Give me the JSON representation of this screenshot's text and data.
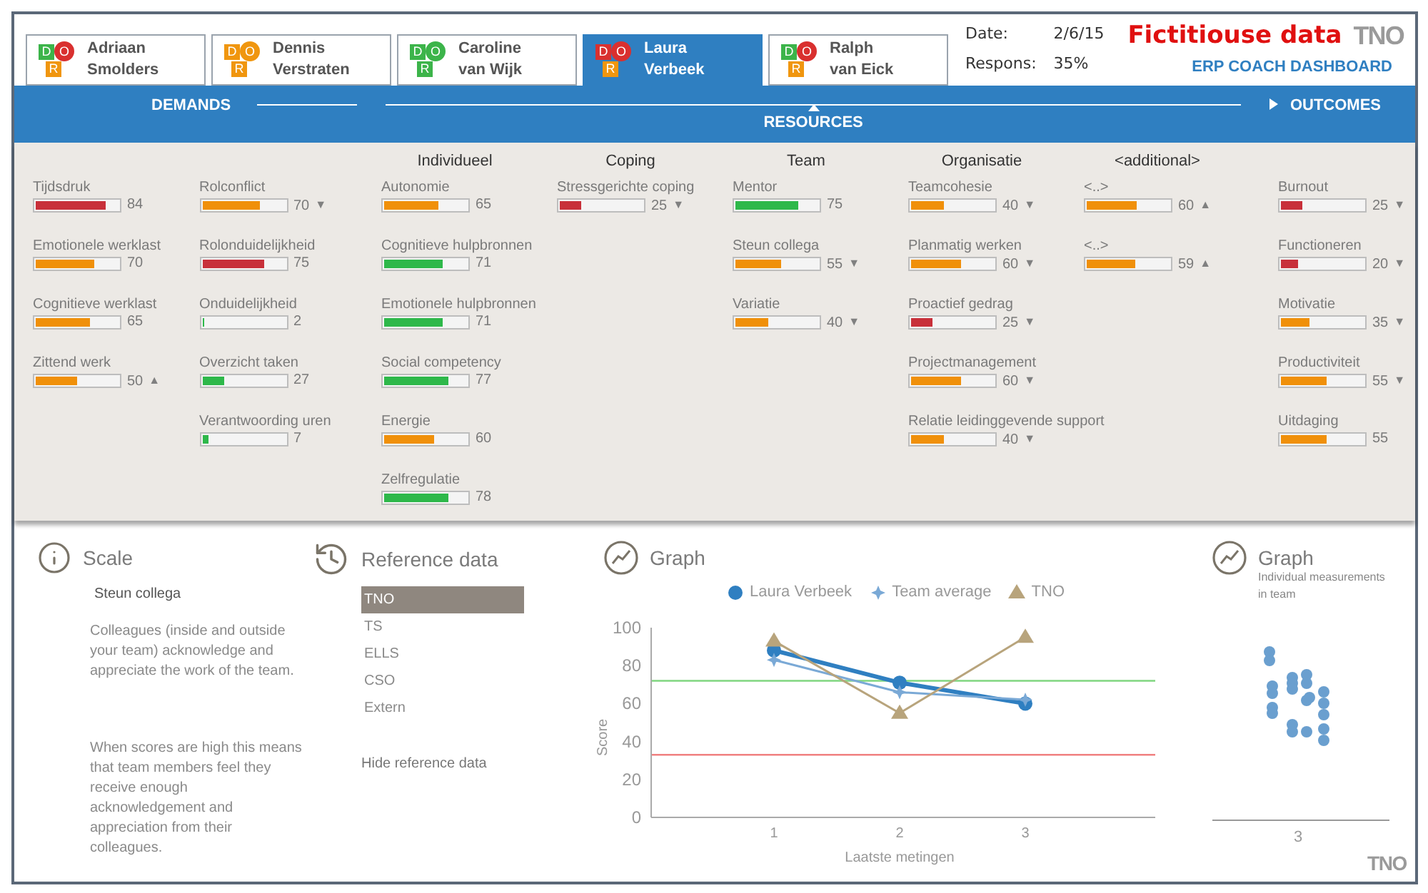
{
  "tabs": [
    {
      "first": "Adriaan",
      "last": "Smolders",
      "selected": false,
      "badges": [
        {
          "letter": "D",
          "color": "#3cb44a"
        },
        {
          "letter": "O",
          "color": "#d9302f"
        },
        {
          "letter": "R",
          "color": "#f0960f"
        }
      ]
    },
    {
      "first": "Dennis",
      "last": "Verstraten",
      "selected": false,
      "badges": [
        {
          "letter": "D",
          "color": "#f0960f"
        },
        {
          "letter": "O",
          "color": "#f0960f"
        },
        {
          "letter": "R",
          "color": "#f0960f"
        }
      ]
    },
    {
      "first": "Caroline",
      "last": "van Wijk",
      "selected": false,
      "badges": [
        {
          "letter": "D",
          "color": "#3cb44a"
        },
        {
          "letter": "O",
          "color": "#3cb44a"
        },
        {
          "letter": "R",
          "color": "#3cb44a"
        }
      ]
    },
    {
      "first": "Laura",
      "last": "Verbeek",
      "selected": true,
      "badges": [
        {
          "letter": "D",
          "color": "#d9302f"
        },
        {
          "letter": "O",
          "color": "#d9302f"
        },
        {
          "letter": "R",
          "color": "#f0960f"
        }
      ]
    },
    {
      "first": "Ralph",
      "last": "van Eick",
      "selected": false,
      "badges": [
        {
          "letter": "D",
          "color": "#3cb44a"
        },
        {
          "letter": "O",
          "color": "#d9302f"
        },
        {
          "letter": "R",
          "color": "#f0960f"
        }
      ]
    }
  ],
  "header": {
    "date_label": "Date:",
    "date": "2/6/15",
    "response_label": "Respons:",
    "response": "35%",
    "notice": "Fictitiouse data",
    "logo": "TNO",
    "title": "ERP COACH DASHBOARD"
  },
  "nav": {
    "demands": "DEMANDS",
    "resources": "RESOURCES",
    "outcomes": "OUTCOMES"
  },
  "demands": {
    "columns": [
      [
        {
          "label": "Tijdsdruk",
          "value": "84",
          "level": 0.84,
          "color": "#c8303a"
        },
        {
          "label": "Emotionele werklast",
          "value": "70",
          "level": 0.7,
          "color": "#f0900a"
        },
        {
          "label": "Cognitieve werklast",
          "value": "65",
          "level": 0.65,
          "color": "#f0900a"
        },
        {
          "label": "Zittend werk",
          "value": "50",
          "level": 0.5,
          "color": "#f0900a",
          "arrow": "▲"
        }
      ],
      [
        {
          "label": "Rolconflict",
          "value": "70",
          "level": 0.7,
          "color": "#f0900a",
          "arrow": "▼"
        },
        {
          "label": "Rolonduidelijkheid",
          "value": "75",
          "level": 0.75,
          "color": "#c8303a"
        },
        {
          "label": "Onduidelijkheid",
          "value": "2",
          "level": 0.02,
          "color": "#2eb84a"
        },
        {
          "label": "Overzicht taken",
          "value": "27",
          "level": 0.27,
          "color": "#2eb84a"
        },
        {
          "label": "Verantwoording uren",
          "value": "7",
          "level": 0.07,
          "color": "#2eb84a"
        }
      ]
    ]
  },
  "resources": {
    "columns": [
      {
        "heading": "Individueel",
        "metrics": [
          {
            "label": "Autonomie",
            "value": "65",
            "level": 0.65,
            "color": "#f0900a"
          },
          {
            "label": "Cognitieve hulpbronnen",
            "value": "71",
            "level": 0.71,
            "color": "#2eb84a"
          },
          {
            "label": "Emotionele hulpbronnen",
            "value": "71",
            "level": 0.71,
            "color": "#2eb84a"
          },
          {
            "label": "Social competency",
            "value": "77",
            "level": 0.77,
            "color": "#2eb84a"
          },
          {
            "label": "Energie",
            "value": "60",
            "level": 0.6,
            "color": "#f0900a"
          },
          {
            "label": "Zelfregulatie",
            "value": "78",
            "level": 0.78,
            "color": "#2eb84a"
          }
        ]
      },
      {
        "heading": "Coping",
        "metrics": [
          {
            "label": "Stressgerichte coping",
            "value": "25",
            "level": 0.25,
            "color": "#c8303a",
            "arrow": "▼"
          }
        ]
      },
      {
        "heading": "Team",
        "metrics": [
          {
            "label": "Mentor",
            "value": "75",
            "level": 0.75,
            "color": "#2eb84a"
          },
          {
            "label": "Steun collega",
            "value": "55",
            "level": 0.55,
            "color": "#f0900a",
            "arrow": "▼"
          },
          {
            "label": "Variatie",
            "value": "40",
            "level": 0.4,
            "color": "#f0900a",
            "arrow": "▼"
          }
        ]
      },
      {
        "heading": "Organisatie",
        "metrics": [
          {
            "label": "Teamcohesie",
            "value": "40",
            "level": 0.4,
            "color": "#f0900a",
            "arrow": "▼"
          },
          {
            "label": "Planmatig werken",
            "value": "60",
            "level": 0.6,
            "color": "#f0900a",
            "arrow": "▼"
          },
          {
            "label": "Proactief gedrag",
            "value": "25",
            "level": 0.25,
            "color": "#c8303a",
            "arrow": "▼"
          },
          {
            "label": "Projectmanagement",
            "value": "60",
            "level": 0.6,
            "color": "#f0900a",
            "arrow": "▼"
          },
          {
            "label": "Relatie leidinggevende support",
            "value": "40",
            "level": 0.4,
            "color": "#f0900a",
            "arrow": "▼"
          }
        ]
      },
      {
        "heading": "<additional>",
        "metrics": [
          {
            "label": "<..>",
            "value": "60",
            "level": 0.6,
            "color": "#f0900a",
            "arrow": "▲"
          },
          {
            "label": "<..>",
            "value": "59",
            "level": 0.59,
            "color": "#f0900a",
            "arrow": "▲"
          }
        ]
      }
    ]
  },
  "outcomes": {
    "metrics": [
      {
        "label": "Burnout",
        "value": "25",
        "level": 0.25,
        "color": "#c8303a",
        "arrow": "▼"
      },
      {
        "label": "Functioneren",
        "value": "20",
        "level": 0.2,
        "color": "#c8303a",
        "arrow": "▼"
      },
      {
        "label": "Motivatie",
        "value": "35",
        "level": 0.35,
        "color": "#f0900a",
        "arrow": "▼"
      },
      {
        "label": "Productiviteit",
        "value": "55",
        "level": 0.55,
        "color": "#f0900a",
        "arrow": "▼"
      },
      {
        "label": "Uitdaging",
        "value": "55",
        "level": 0.55,
        "color": "#f0900a"
      }
    ]
  },
  "scale": {
    "title": "Scale",
    "subject": "Steun collega",
    "description": "Colleagues (inside and outside your team) acknowledge and appreciate the work of the team.",
    "interpretation": "When scores are high this means that team members feel they receive enough acknowledgement and appreciation from their colleagues."
  },
  "reference": {
    "title": "Reference data",
    "items": [
      {
        "label": "TNO",
        "selected": true
      },
      {
        "label": "TS",
        "selected": false
      },
      {
        "label": "ELLS",
        "selected": false
      },
      {
        "label": "CSO",
        "selected": false
      },
      {
        "label": "Extern",
        "selected": false
      }
    ],
    "hide": "Hide reference data"
  },
  "graph": {
    "title": "Graph",
    "chart_data": {
      "type": "line",
      "xlabel": "Laatste metingen",
      "ylabel": "Score",
      "categories": [
        "1",
        "2",
        "3"
      ],
      "series": [
        {
          "name": "Laura Verbeek",
          "color": "#2f7fc1",
          "marker": "circle",
          "values": [
            88,
            71,
            60
          ]
        },
        {
          "name": "Team average",
          "color": "#7aa9d6",
          "marker": "star",
          "values": [
            83,
            66,
            62
          ]
        },
        {
          "name": "TNO",
          "color": "#b8a47c",
          "marker": "triangle",
          "values": [
            93,
            55,
            95
          ]
        }
      ],
      "ylim": [
        0,
        100
      ],
      "yticks": [
        0,
        20,
        40,
        60,
        80,
        100
      ],
      "ref_lines": [
        {
          "axis": "y",
          "value": 72,
          "color": "#7fd67f"
        },
        {
          "axis": "y",
          "value": 33,
          "color": "#f08080"
        }
      ]
    }
  },
  "team_graph": {
    "title": "Graph",
    "subtitle": "Individual measurements in team",
    "x_label": "3"
  },
  "footer_logo": "TNO"
}
